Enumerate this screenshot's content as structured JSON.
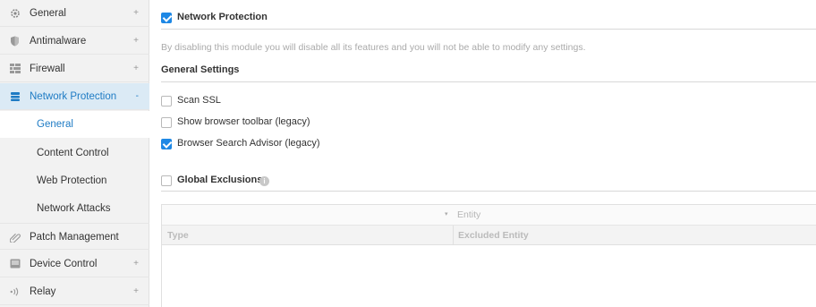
{
  "sidebar": {
    "items": [
      {
        "label": "General",
        "icon": "gear-icon",
        "expand": "+"
      },
      {
        "label": "Antimalware",
        "icon": "shield-icon",
        "expand": "+"
      },
      {
        "label": "Firewall",
        "icon": "firewall-icon",
        "expand": "+"
      },
      {
        "label": "Network Protection",
        "icon": "network-protection-icon",
        "expand": "-"
      },
      {
        "label": "Patch Management",
        "icon": "paperclip-icon",
        "expand": ""
      },
      {
        "label": "Device Control",
        "icon": "device-icon",
        "expand": "+"
      },
      {
        "label": "Relay",
        "icon": "relay-icon",
        "expand": "+"
      }
    ],
    "subitems": [
      {
        "label": "General"
      },
      {
        "label": "Content Control"
      },
      {
        "label": "Web Protection"
      },
      {
        "label": "Network Attacks"
      }
    ]
  },
  "main": {
    "module_label": "Network Protection",
    "module_checked": true,
    "disable_note": "By disabling this module you will disable all its features and you will not be able to modify any settings.",
    "general_settings_title": "General Settings",
    "options": [
      {
        "label": "Scan SSL",
        "checked": false
      },
      {
        "label": "Show browser toolbar (legacy)",
        "checked": false
      },
      {
        "label": "Browser Search Advisor (legacy)",
        "checked": true
      }
    ],
    "global_exclusions_label": "Global Exclusions",
    "global_exclusions_checked": false,
    "info_glyph": "i"
  },
  "table": {
    "filter_placeholder": "Entity",
    "filter_arrow": "▾",
    "columns": [
      "Type",
      "Excluded Entity"
    ]
  },
  "colors": {
    "accent": "#1e88e5",
    "active_bg": "#dbeaf5",
    "active_text": "#1e7bc4"
  }
}
